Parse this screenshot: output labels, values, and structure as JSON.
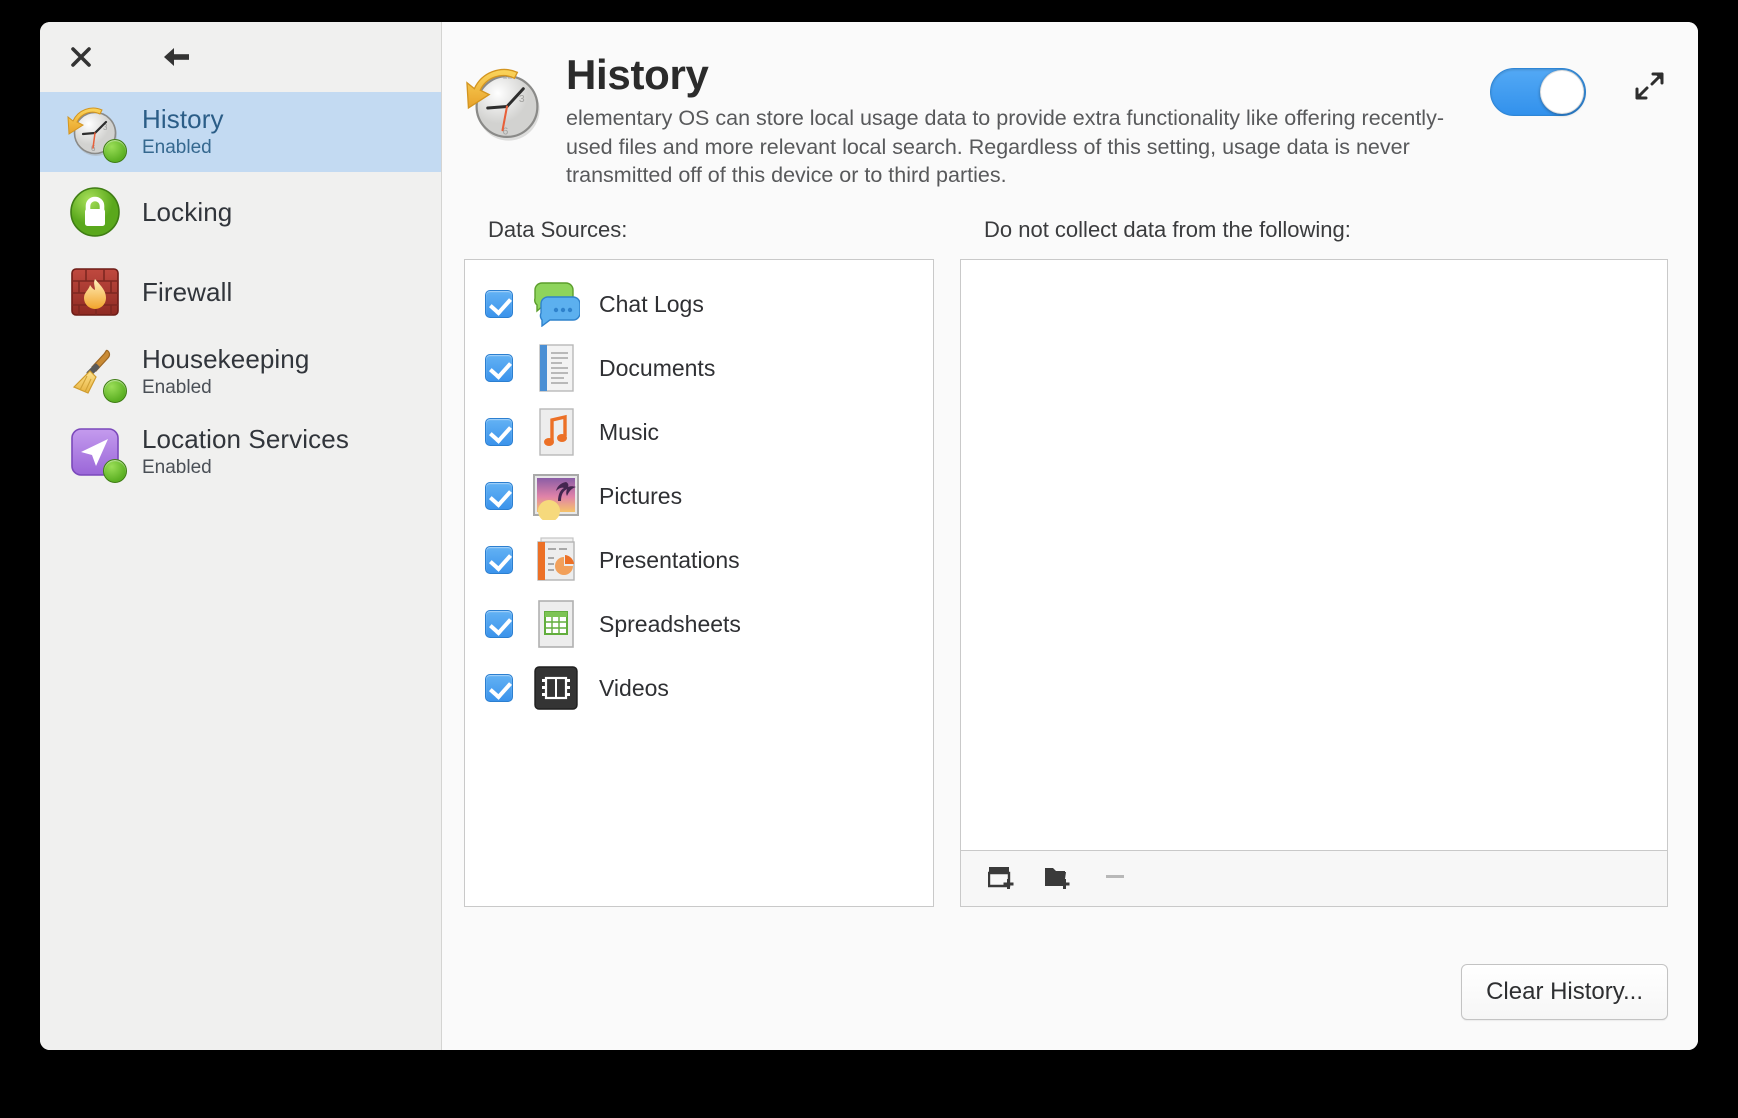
{
  "window": {
    "titlebar": {
      "close_icon": "close-icon",
      "back_icon": "back-arrow-icon"
    }
  },
  "sidebar": {
    "items": [
      {
        "label": "History",
        "status": "Enabled",
        "icon": "history-clock-icon",
        "selected": true,
        "has_emblem": true
      },
      {
        "label": "Locking",
        "status": "",
        "icon": "lock-icon",
        "selected": false,
        "has_emblem": false
      },
      {
        "label": "Firewall",
        "status": "",
        "icon": "firewall-brick-flame-icon",
        "selected": false,
        "has_emblem": false
      },
      {
        "label": "Housekeeping",
        "status": "Enabled",
        "icon": "broom-icon",
        "selected": false,
        "has_emblem": true
      },
      {
        "label": "Location Services",
        "status": "Enabled",
        "icon": "location-arrow-icon",
        "selected": false,
        "has_emblem": true
      }
    ]
  },
  "main": {
    "icon": "history-clock-icon",
    "title": "History",
    "description": "elementary OS can store local usage data to provide extra functionality like offering recently-used files and more relevant local search. Regardless of this setting, usage data is never transmitted off of this device or to third parties.",
    "toggle": {
      "name": "history-enabled-toggle",
      "state": "on"
    },
    "expand_icon": "expand-arrows-icon"
  },
  "data_sources": {
    "label": "Data Sources:",
    "items": [
      {
        "label": "Chat Logs",
        "icon": "chat-bubbles-icon",
        "checked": true
      },
      {
        "label": "Documents",
        "icon": "document-icon",
        "checked": true
      },
      {
        "label": "Music",
        "icon": "music-note-icon",
        "checked": true
      },
      {
        "label": "Pictures",
        "icon": "picture-icon",
        "checked": true
      },
      {
        "label": "Presentations",
        "icon": "presentation-icon",
        "checked": true
      },
      {
        "label": "Spreadsheets",
        "icon": "spreadsheet-icon",
        "checked": true
      },
      {
        "label": "Videos",
        "icon": "video-film-icon",
        "checked": true
      }
    ]
  },
  "exclusions": {
    "label": "Do not collect data from the following:",
    "items": [],
    "toolbar": [
      {
        "name": "add-application-button",
        "icon": "add-window-icon",
        "enabled": true
      },
      {
        "name": "add-folder-button",
        "icon": "add-folder-icon",
        "enabled": true
      },
      {
        "name": "remove-button",
        "icon": "minus-icon",
        "enabled": false
      }
    ]
  },
  "footer": {
    "clear_history_label": "Clear History..."
  },
  "colors": {
    "accent": "#3d9bf0",
    "selection": "#c3daf2",
    "selected_text": "#2b5d87",
    "window_bg": "#fafafa",
    "sidebar_bg": "#f0f0ef"
  }
}
